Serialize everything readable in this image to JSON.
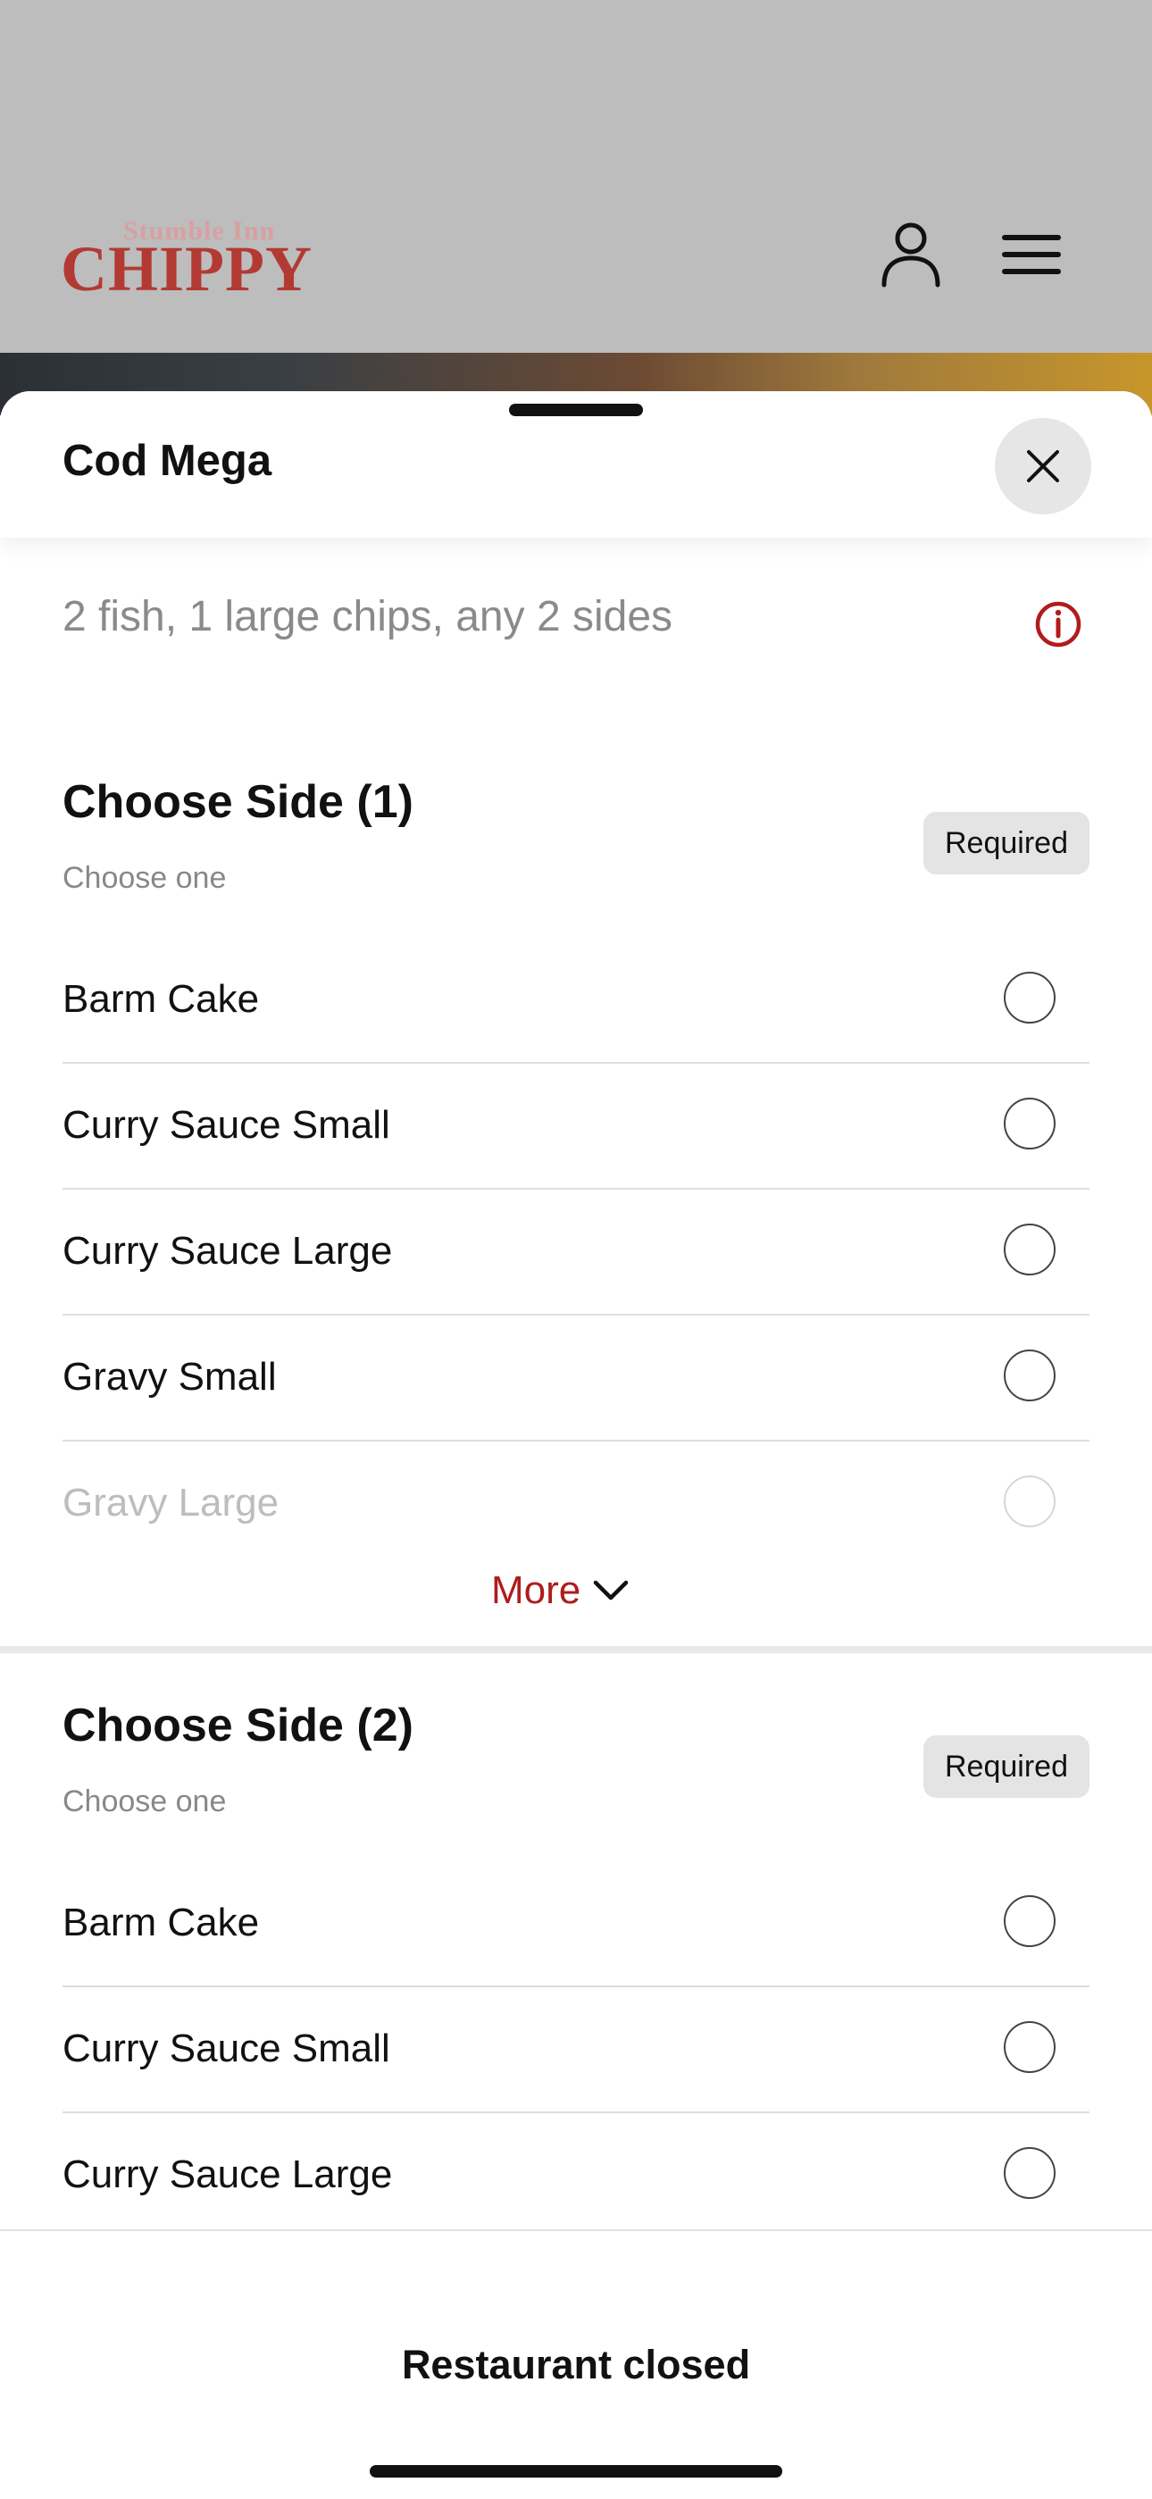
{
  "brand": {
    "tagline": "Stumble Inn",
    "name": "CHIPPY"
  },
  "header_icons": {
    "account": "account-icon",
    "menu": "hamburger-menu-icon"
  },
  "sheet": {
    "title": "Cod Mega",
    "close_icon": "close-icon",
    "description": "2 fish, 1 large chips, any 2 sides",
    "info_icon": "info-icon"
  },
  "groups": [
    {
      "title": "Choose Side (1)",
      "subtitle": "Choose one",
      "badge": "Required",
      "options": [
        "Barm Cake",
        "Curry Sauce Small",
        "Curry Sauce Large",
        "Gravy Small",
        "Gravy Large"
      ],
      "more_label": "More"
    },
    {
      "title": "Choose Side (2)",
      "subtitle": "Choose one",
      "badge": "Required",
      "options": [
        "Barm Cake",
        "Curry Sauce Small",
        "Curry Sauce Large"
      ]
    }
  ],
  "footer": {
    "status": "Restaurant closed"
  },
  "colors": {
    "accent": "#b01c1c",
    "badge_bg": "#e4e4e4",
    "dim_header": "#bdbdbd"
  }
}
